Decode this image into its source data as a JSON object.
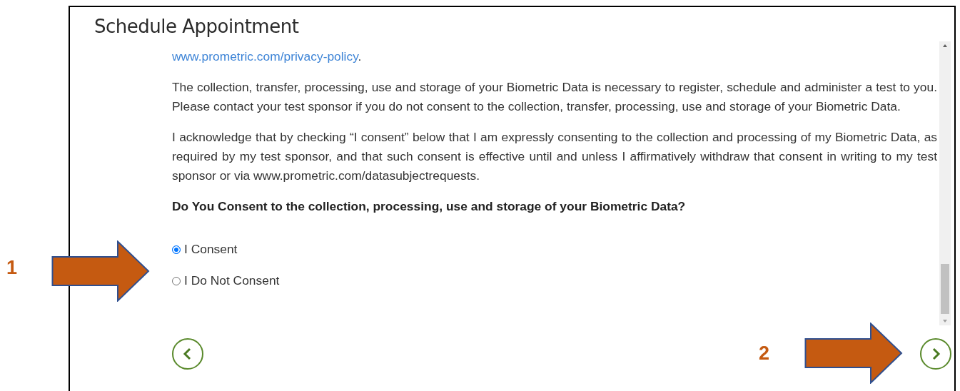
{
  "title": "Schedule Appointment",
  "content": {
    "paragraphs": [
      {
        "parts": [
          {
            "kind": "link",
            "text": "www.prometric.com/privacy-policy"
          },
          {
            "kind": "text",
            "text": "."
          }
        ]
      },
      {
        "parts": [
          {
            "kind": "text",
            "text": "The collection, transfer, processing, use and storage of your Biometric Data is necessary to register, schedule and administer a test to you. Please contact your test sponsor if you do not consent to the collection, transfer, processing, use and storage of your Biometric Data."
          }
        ]
      },
      {
        "parts": [
          {
            "kind": "text",
            "text": "I acknowledge that by checking “I consent” below that I am expressly consenting to the collection and processing of my Biometric Data, as required by my test sponsor, and that such consent is effective until and unless I affirmatively withdraw that consent in writing to my test sponsor or via www.prometric.com/datasubjectrequests."
          }
        ]
      }
    ],
    "question": "Do You Consent to the collection, processing, use and storage of your Biometric Data?",
    "options": [
      {
        "label": "I Consent",
        "selected": true
      },
      {
        "label": "I Do Not Consent",
        "selected": false
      }
    ]
  },
  "annotations": [
    {
      "label": "1"
    },
    {
      "label": "2"
    }
  ]
}
